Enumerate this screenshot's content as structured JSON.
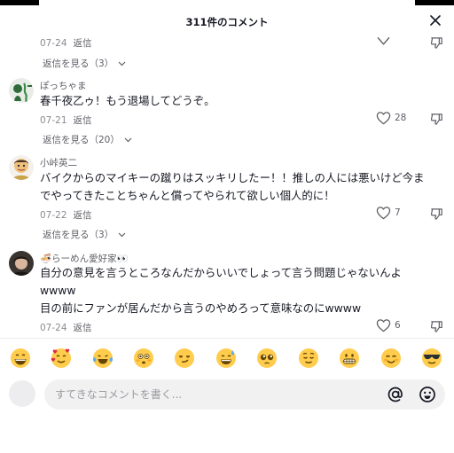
{
  "header": {
    "title": "311件のコメント"
  },
  "partial_comment": {
    "date": "07-24",
    "reply_label": "返信"
  },
  "partial_more": {
    "label": "返信を見る（3）"
  },
  "comments": [
    {
      "username": "ぽっちゃま",
      "lines": [
        "春千夜乙ゥ！もう退場してどうぞ。"
      ],
      "date": "07-21",
      "reply_label": "返信",
      "likes": "28",
      "more_replies": "返信を見る（20）"
    },
    {
      "username": "小峠英二",
      "lines": [
        "バイクからのマイキーの蹴りはスッキリしたー！！推しの人には悪いけど今ま",
        "でやってきたことちゃんと償ってやられて欲しい個人的に！"
      ],
      "date": "07-22",
      "reply_label": "返信",
      "likes": "7",
      "more_replies": "返信を見る（3）"
    },
    {
      "username": "🍜らーめん愛好家👀",
      "lines": [
        "自分の意見を言うところなんだからいいでしょって言う問題じゃないんよ",
        "wwww",
        "目の前にファンが居んだから言うのやめろって意味なのにwwww"
      ],
      "date": "07-24",
      "reply_label": "返信",
      "likes": "6"
    }
  ],
  "emoji_bar": [
    "grin",
    "smiling-face-with-hearts",
    "joy",
    "flushed",
    "smirk",
    "sweat-smile",
    "pleading",
    "relieved",
    "grimacing",
    "blush",
    "sunglasses"
  ],
  "input": {
    "placeholder": "すてきなコメントを書く..."
  }
}
